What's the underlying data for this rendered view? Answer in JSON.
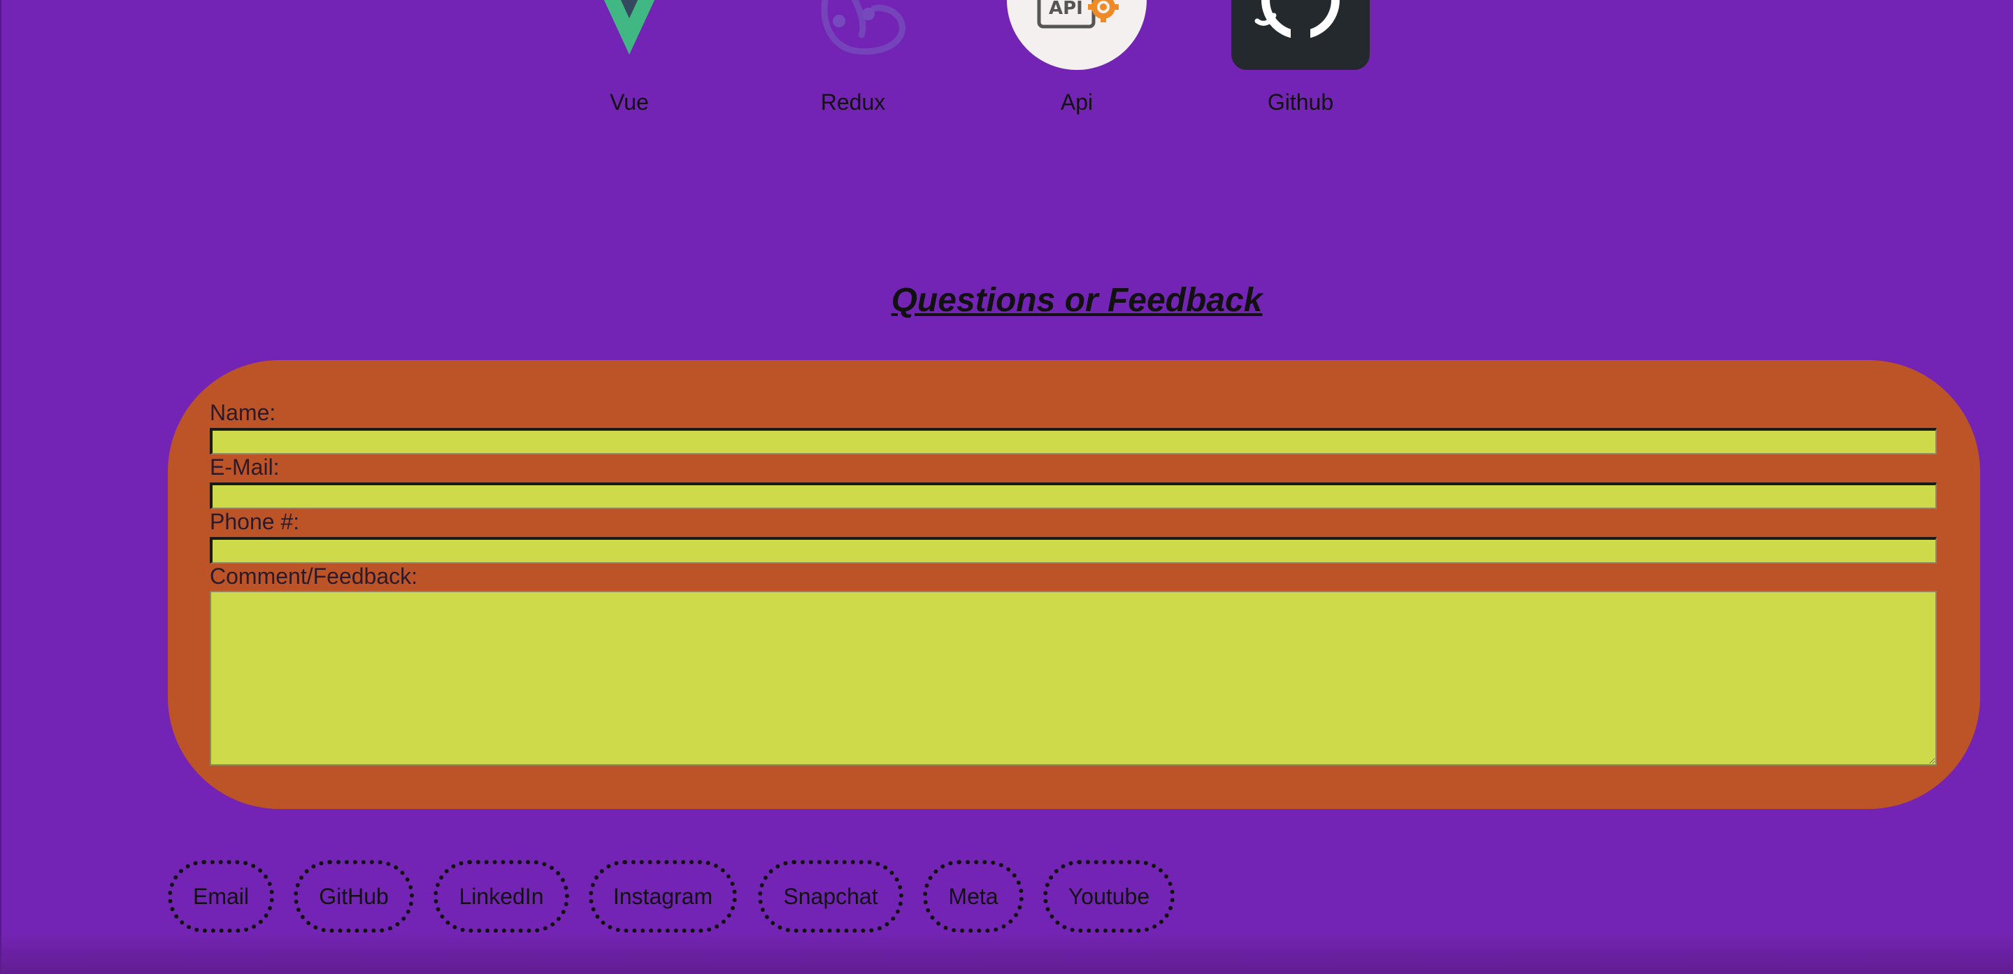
{
  "colors": {
    "page_background": "#7424b4",
    "form_panel": "#bd5428",
    "input_fill": "#cfda4b",
    "vue_green": "#41b883",
    "vue_dark": "#35495e",
    "redux_purple": "#764abc",
    "github_dark": "#24292e"
  },
  "tech_stack": [
    {
      "label": "Vue",
      "icon": "vue-logo-icon"
    },
    {
      "label": "Redux",
      "icon": "redux-logo-icon"
    },
    {
      "label": "Api",
      "icon": "api-gear-icon",
      "icon_text": "API"
    },
    {
      "label": "Github",
      "icon": "github-octocat-icon"
    }
  ],
  "feedback": {
    "title": "Questions or Feedback",
    "fields": {
      "name_label": "Name:",
      "name_value": "",
      "email_label": "E-Mail:",
      "email_value": "",
      "phone_label": "Phone #:",
      "phone_value": "",
      "comment_label": "Comment/Feedback:",
      "comment_value": ""
    }
  },
  "social_links": [
    {
      "label": "Email"
    },
    {
      "label": "GitHub"
    },
    {
      "label": "LinkedIn"
    },
    {
      "label": "Instagram"
    },
    {
      "label": "Snapchat"
    },
    {
      "label": "Meta"
    },
    {
      "label": "Youtube"
    }
  ]
}
